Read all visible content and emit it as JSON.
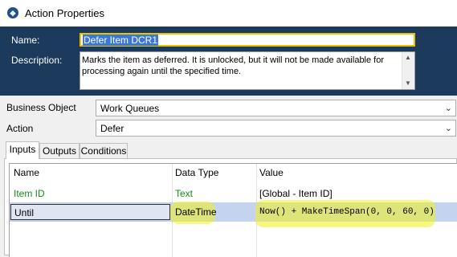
{
  "window": {
    "title": "Action Properties",
    "icon": "blue-prism-object-icon"
  },
  "header": {
    "name_label": "Name:",
    "name_value": "Defer Item DCR1",
    "description_label": "Description:",
    "description_text": "Marks the item as deferred. It is unlocked, but it will not be made available for processing again until the specified time.\n\nT"
  },
  "business_object": {
    "label": "Business Object",
    "value": "Work Queues"
  },
  "action": {
    "label": "Action",
    "value": "Defer"
  },
  "tabs": [
    {
      "label": "Inputs",
      "active": true
    },
    {
      "label": "Outputs",
      "active": false
    },
    {
      "label": "Conditions",
      "active": false
    }
  ],
  "grid": {
    "headers": {
      "name": "Name",
      "data_type": "Data Type",
      "value": "Value"
    },
    "rows": [
      {
        "name": "Item ID",
        "data_type": "Text",
        "value": "[Global - Item ID]"
      },
      {
        "name": "Until",
        "data_type": "DateTime",
        "value": "Now() + MakeTimeSpan(0, 0, 60, 0)"
      }
    ]
  },
  "colors": {
    "header_bg": "#1b3a5c",
    "highlight": "#f0f01a",
    "param_green": "#1a8a1a"
  }
}
